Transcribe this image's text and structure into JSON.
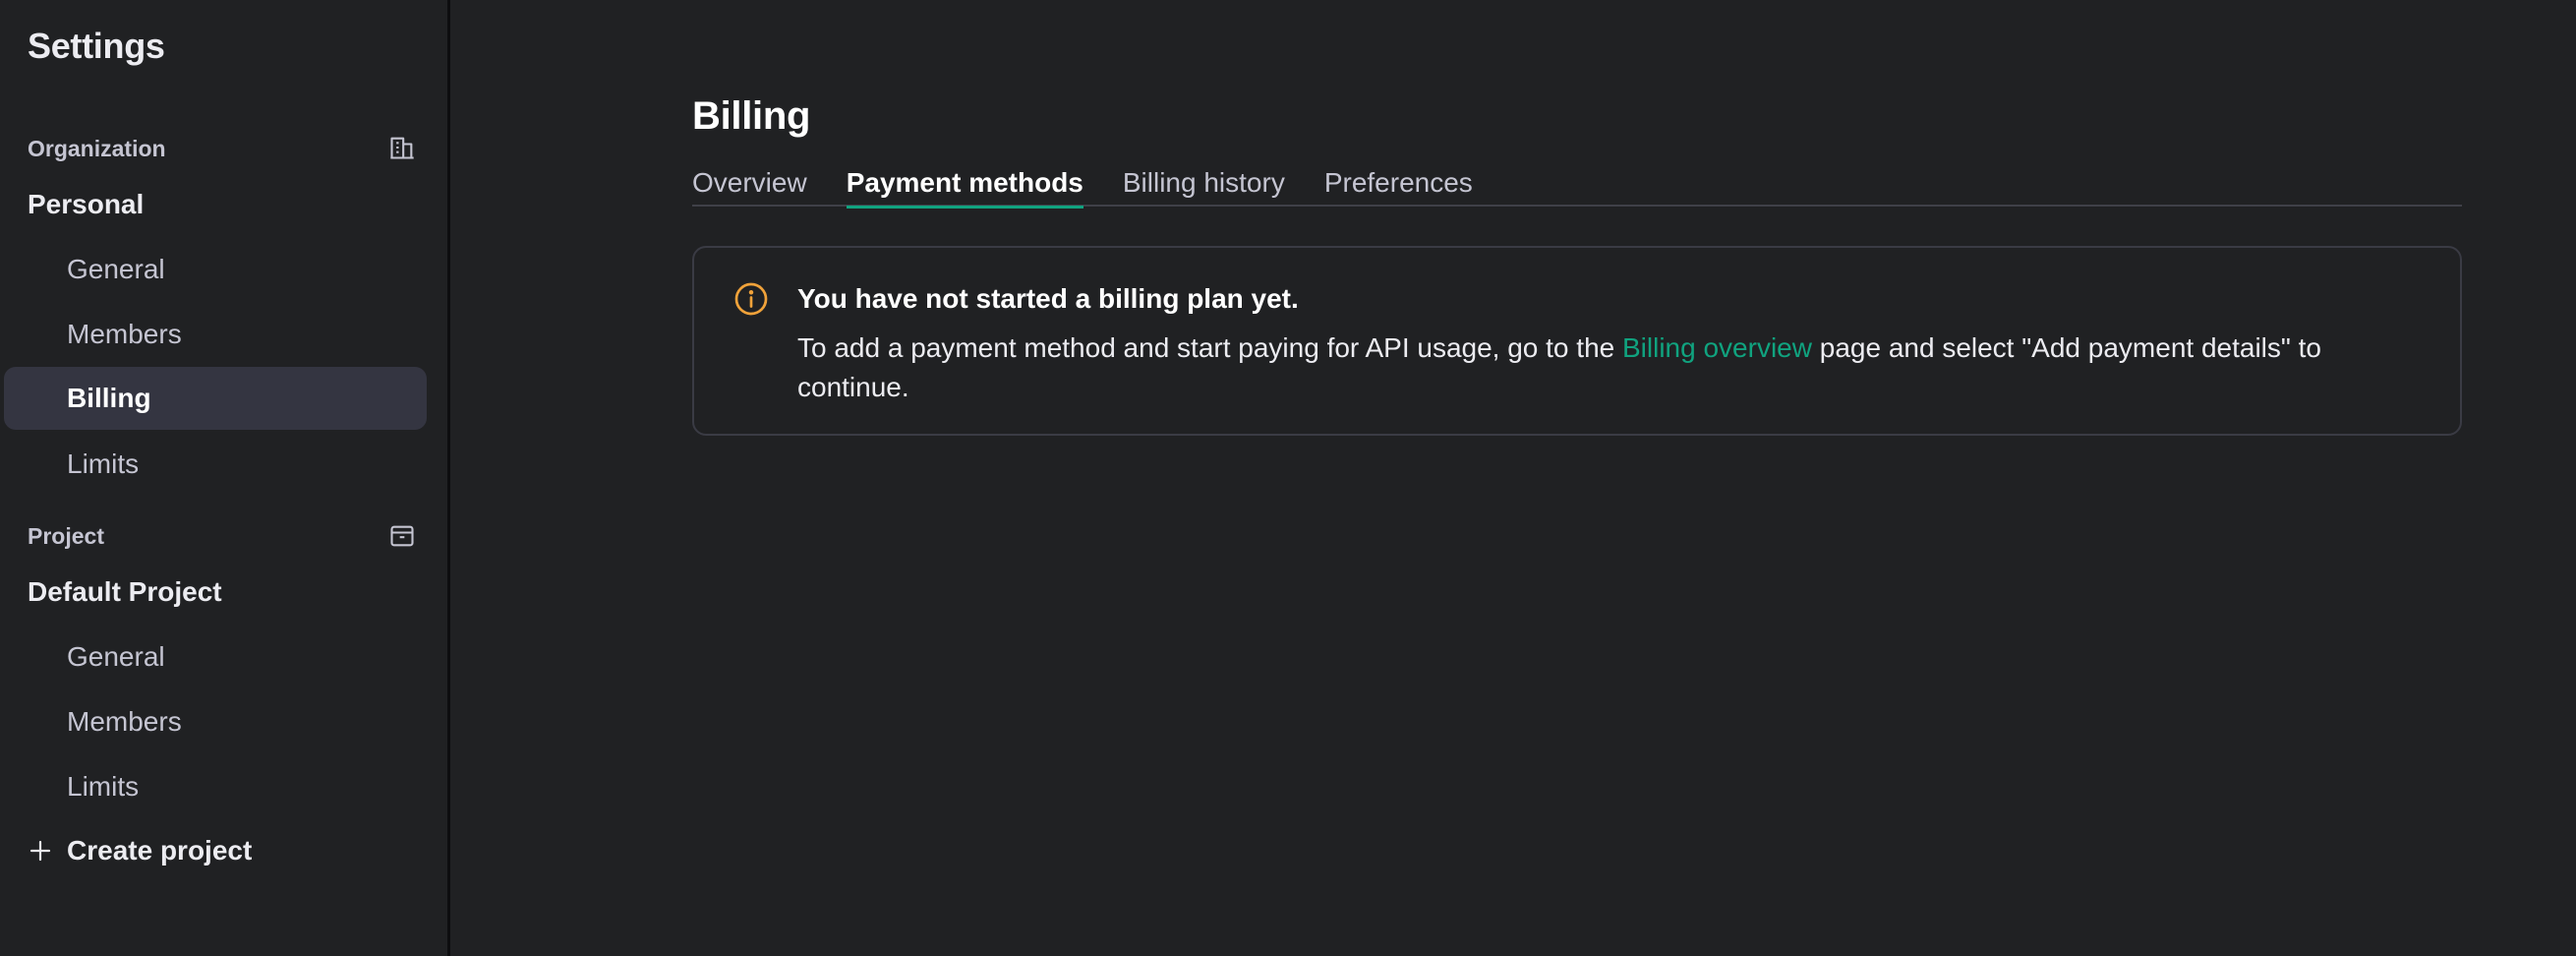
{
  "sidebar": {
    "title": "Settings",
    "organization": {
      "label": "Organization",
      "icon": "building-icon",
      "name": "Personal",
      "items": [
        {
          "label": "General"
        },
        {
          "label": "Members"
        },
        {
          "label": "Billing",
          "active": true
        },
        {
          "label": "Limits"
        }
      ]
    },
    "project": {
      "label": "Project",
      "icon": "archive-box-icon",
      "name": "Default Project",
      "items": [
        {
          "label": "General"
        },
        {
          "label": "Members"
        },
        {
          "label": "Limits"
        }
      ]
    },
    "create_project": {
      "icon": "plus-icon",
      "label": "Create project"
    }
  },
  "main": {
    "title": "Billing",
    "tabs": [
      {
        "label": "Overview"
      },
      {
        "label": "Payment methods",
        "active": true
      },
      {
        "label": "Billing history"
      },
      {
        "label": "Preferences"
      }
    ],
    "notice": {
      "icon": "info-icon",
      "icon_color": "#f0a23a",
      "title": "You have not started a billing plan yet.",
      "body_before": "To add a payment method and start paying for API usage, go to the ",
      "link": "Billing overview",
      "body_after": " page and select \"Add payment details\" to continue."
    }
  },
  "colors": {
    "background": "#202123",
    "active_item_bg": "#343541",
    "accent": "#10a37f",
    "warning": "#f0a23a"
  }
}
